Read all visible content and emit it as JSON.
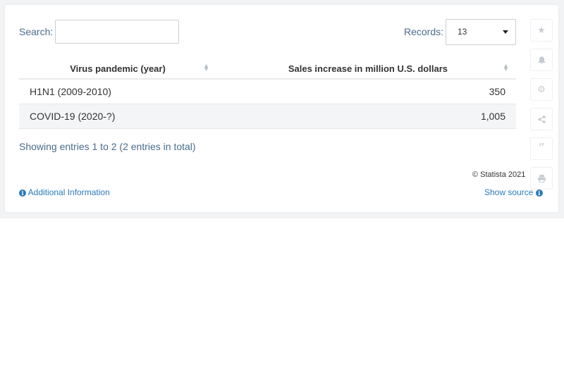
{
  "search": {
    "label": "Search:",
    "value": ""
  },
  "records": {
    "label": "Records:",
    "value": "13"
  },
  "table": {
    "headers": [
      "Virus pandemic (year)",
      "Sales increase in million U.S. dollars"
    ],
    "rows": [
      [
        "H1N1 (2009-2010)",
        "350"
      ],
      [
        "COVID-19 (2020-?)",
        "1,005"
      ]
    ]
  },
  "footer": {
    "info": "Showing entries 1 to 2 (2 entries in total)",
    "credit": "© Statista 2021",
    "additional_info": "Additional Information",
    "show_source": "Show source"
  },
  "sidebar_icons": [
    "star-icon",
    "bell-icon",
    "gear-icon",
    "share-icon",
    "quote-icon",
    "print-icon"
  ]
}
